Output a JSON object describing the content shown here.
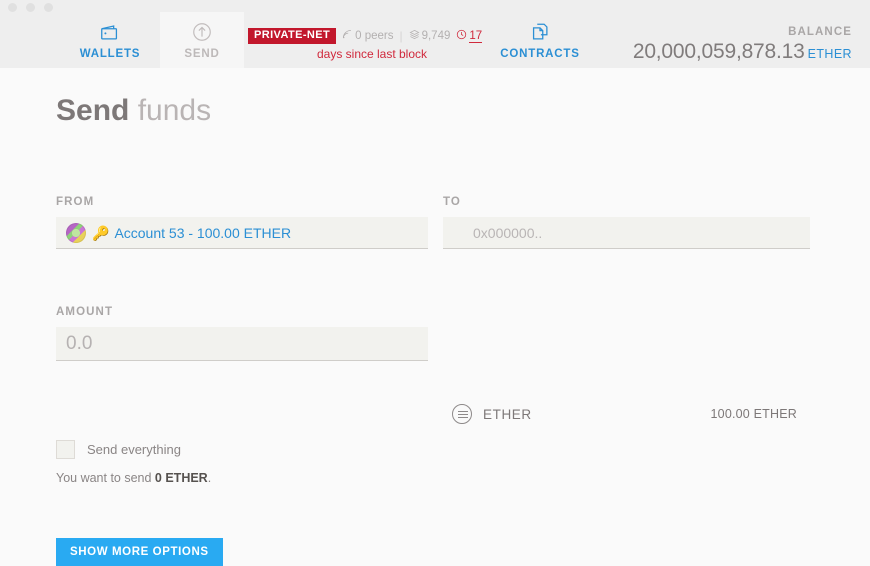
{
  "window": {
    "traffic_lights": [
      "close",
      "minimize",
      "maximize"
    ]
  },
  "header": {
    "tabs": [
      {
        "id": "wallets",
        "label": "WALLETS",
        "icon": "wallet-icon",
        "active": false,
        "color": "#2b8fd4"
      },
      {
        "id": "send",
        "label": "SEND",
        "icon": "arrow-up-circle-icon",
        "active": true,
        "color": "#bdb9b9"
      },
      {
        "id": "contracts",
        "label": "CONTRACTS",
        "icon": "documents-icon",
        "active": false,
        "color": "#2b8fd4"
      }
    ],
    "network": {
      "badge": "PRIVATE-NET",
      "badge_color": "#c2172c",
      "peers": "0 peers",
      "peers_icon": "signal-icon",
      "separator": "|",
      "block_number": "9,749",
      "block_icon": "blocks-icon",
      "last_block_time": "17",
      "last_block_icon": "clock-icon",
      "last_block_note": "days since last block",
      "alert_color": "#d0293c"
    },
    "balance": {
      "label": "BALANCE",
      "amount": "20,000,059,878.13",
      "unit": "ETHER",
      "unit_color": "#2b8fd4"
    }
  },
  "main": {
    "title_strong": "Send",
    "title_light": "funds",
    "from": {
      "label": "FROM",
      "avatar_icon": "identicon-avatar",
      "key_icon": "key-icon",
      "value": "Account 53 - 100.00 ETHER"
    },
    "to": {
      "label": "TO",
      "value": "",
      "placeholder": "0x000000.."
    },
    "amount": {
      "label": "AMOUNT",
      "value": "",
      "placeholder": "0.0"
    },
    "currency": {
      "icon": "list-circle-icon",
      "name": "ETHER",
      "available": "100.00 ETHER"
    },
    "send_everything": {
      "label": "Send everything",
      "checked": false
    },
    "summary_prefix": "You want to send ",
    "summary_amount": "0 ETHER",
    "summary_suffix": ".",
    "show_more_button": "SHOW MORE OPTIONS",
    "accent_color": "#29aaf2"
  }
}
